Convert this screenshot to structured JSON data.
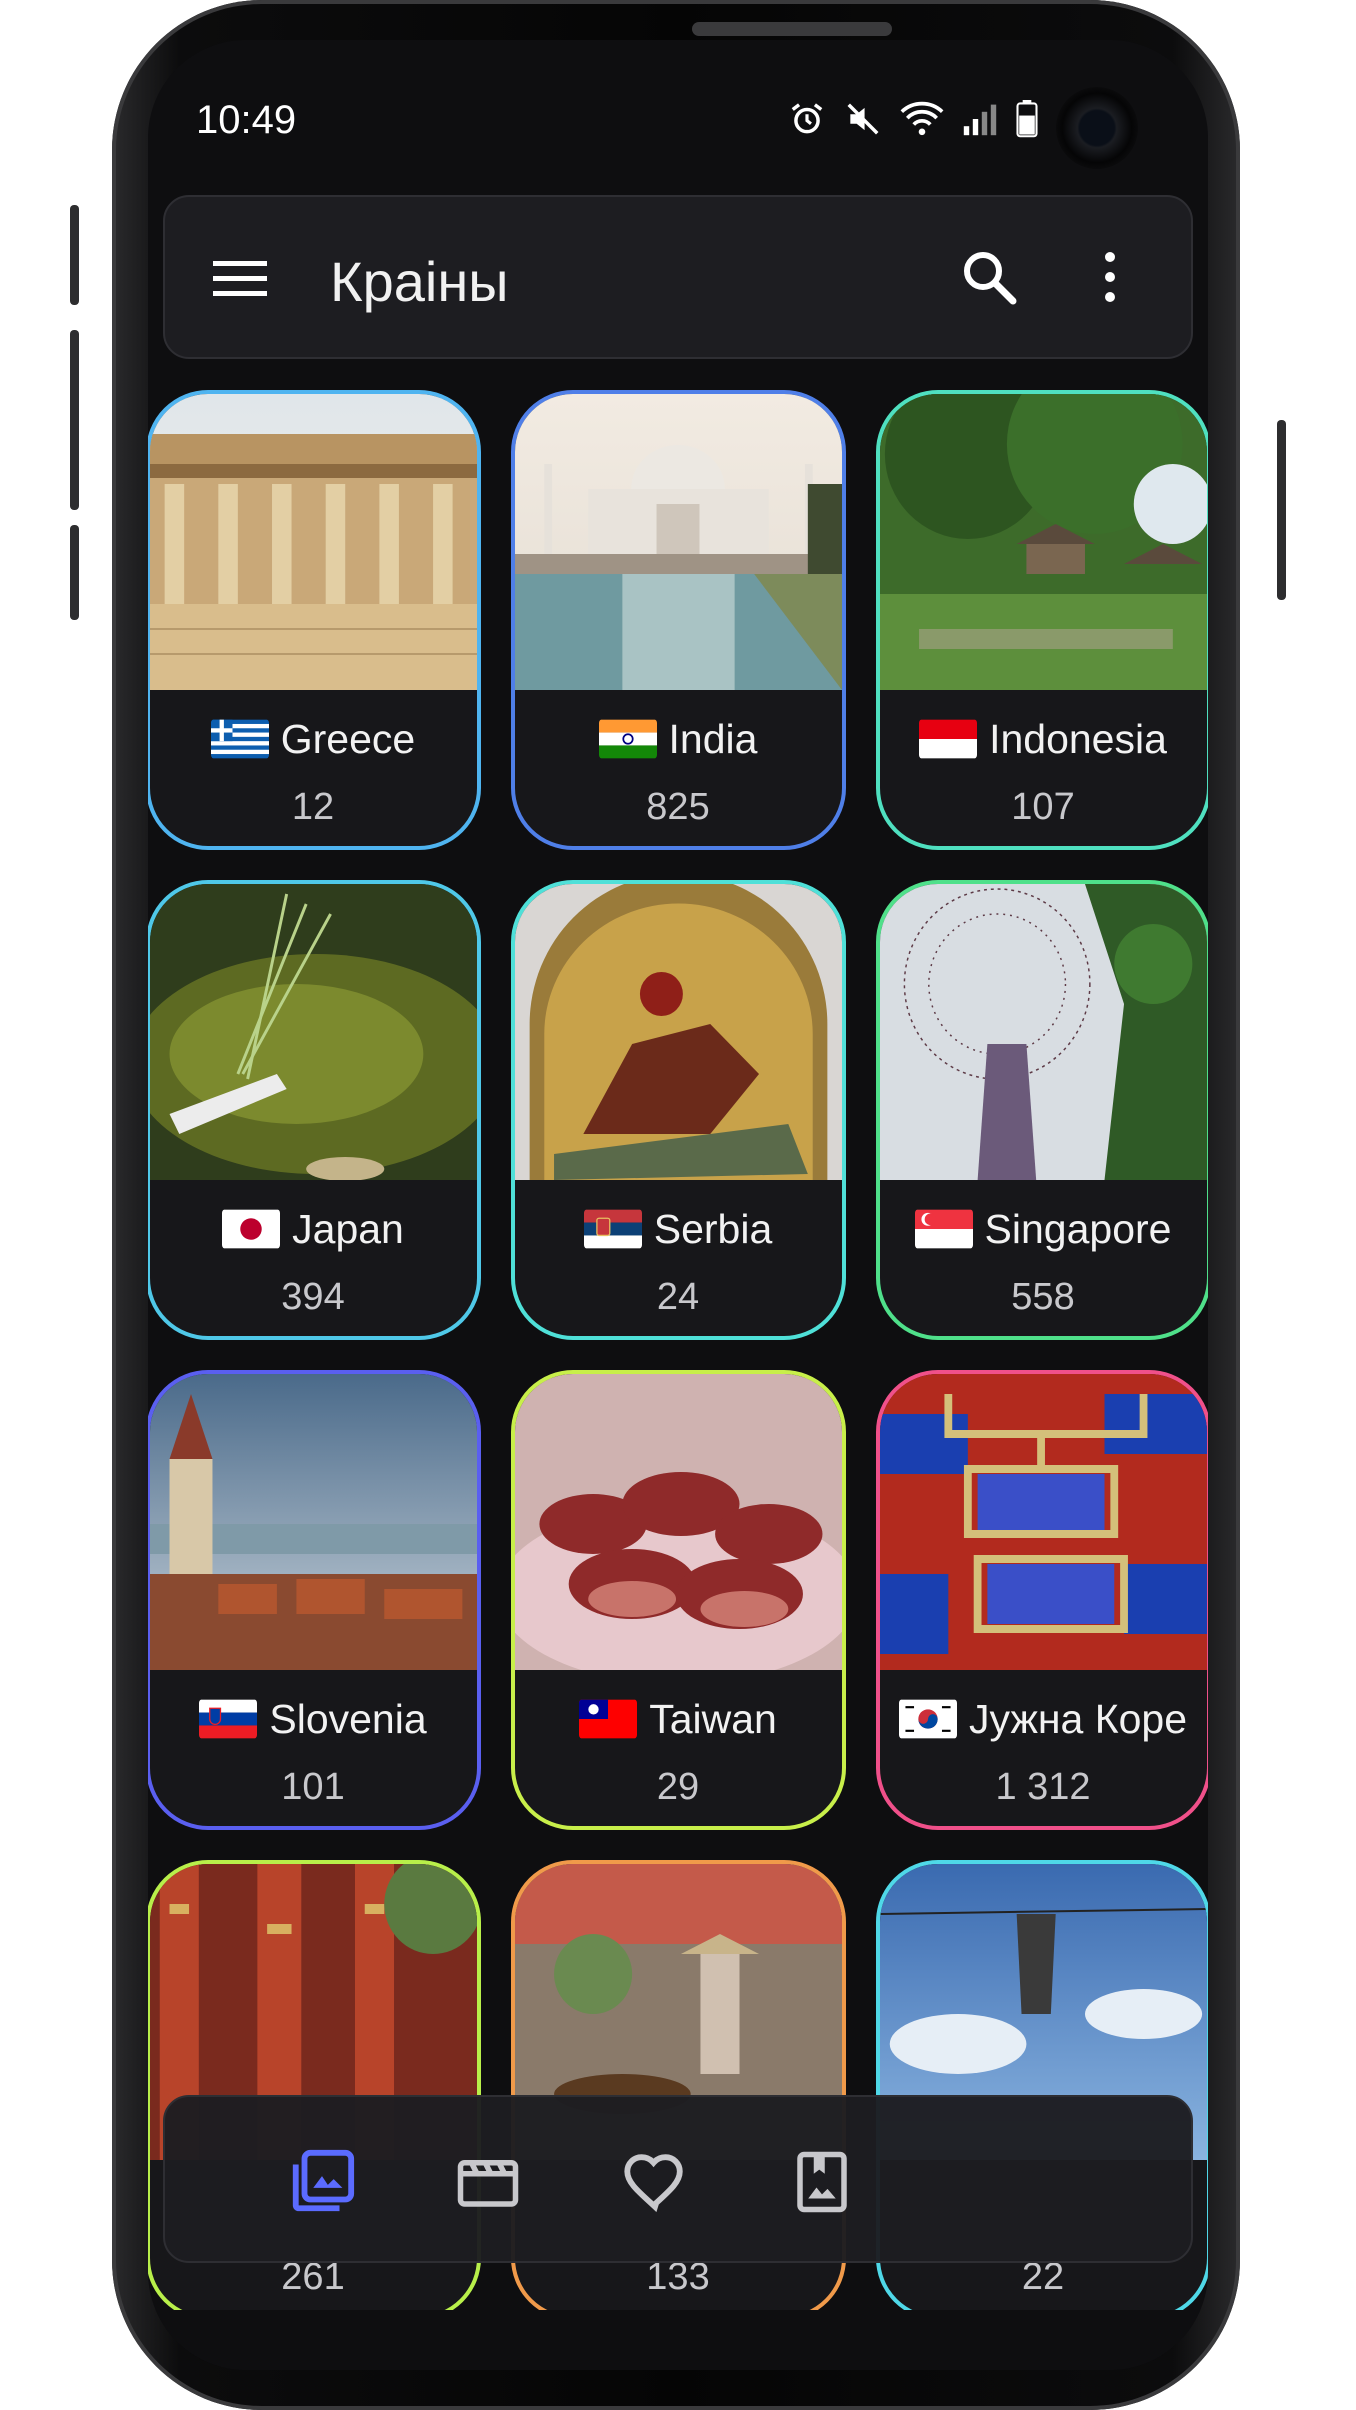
{
  "status_bar": {
    "time": "10:49"
  },
  "app_bar": {
    "title": "Краіны"
  },
  "accent_color": "#5b6bff",
  "countries": [
    {
      "name": "Greece",
      "count": "12",
      "border": "#4fb4f0"
    },
    {
      "name": "India",
      "count": "825",
      "border": "#4f7fe8"
    },
    {
      "name": "Indonesia",
      "count": "107",
      "border": "#4fe0c0"
    },
    {
      "name": "Japan",
      "count": "394",
      "border": "#4fc8e8"
    },
    {
      "name": "Serbia",
      "count": "24",
      "border": "#4fe0d8"
    },
    {
      "name": "Singapore",
      "count": "558",
      "border": "#4fe08a"
    },
    {
      "name": "Slovenia",
      "count": "101",
      "border": "#5a5ff0"
    },
    {
      "name": "Taiwan",
      "count": "29",
      "border": "#c8ef4a"
    },
    {
      "name": "Јужна Коре",
      "count": "1 312",
      "border": "#f0508a"
    },
    {
      "name": "",
      "count": "261",
      "border": "#b8ef4a"
    },
    {
      "name": "",
      "count": "133",
      "border": "#f09a4a"
    },
    {
      "name": "",
      "count": "22",
      "border": "#4fd8e8"
    }
  ],
  "bottom_nav": {
    "items": [
      {
        "icon": "photo-library-icon",
        "active": true
      },
      {
        "icon": "movie-clapper-icon",
        "active": false
      },
      {
        "icon": "heart-icon",
        "active": false
      },
      {
        "icon": "bookmark-photo-icon",
        "active": false
      }
    ]
  }
}
